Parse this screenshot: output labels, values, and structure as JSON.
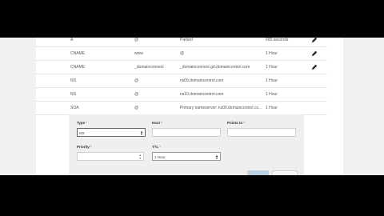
{
  "records": [
    {
      "type": "A",
      "name": "@",
      "value": "Parked",
      "ttl": "600 seconds"
    },
    {
      "type": "CNAME",
      "name": "www",
      "value": "@",
      "ttl": "1 Hour"
    },
    {
      "type": "CNAME",
      "name": "_domainconnect",
      "value": "_domainconnect.gd.domaincontrol.com",
      "ttl": "1 Hour"
    },
    {
      "type": "NS",
      "name": "@",
      "value": "ns09.domaincontrol.com",
      "ttl": "1 Hour"
    },
    {
      "type": "NS",
      "name": "@",
      "value": "ns10.domaincontrol.com",
      "ttl": "1 Hour"
    },
    {
      "type": "SOA",
      "name": "@",
      "value": "Primary nameserver: ns09.domaincontrol.co...",
      "ttl": "1 Hour"
    }
  ],
  "form": {
    "type_label": "Type",
    "type_value": "MX",
    "host_label": "Host",
    "host_value": "",
    "points_label": "Points to",
    "points_value": "",
    "priority_label": "Priority",
    "priority_value": "",
    "ttl_label": "TTL",
    "ttl_value": "1 Hour",
    "required_mark": "*"
  },
  "icons": {
    "edit": "pencil-icon",
    "dropdown": "chevron-down-icon",
    "stepper": "spinner-arrows-icon"
  }
}
